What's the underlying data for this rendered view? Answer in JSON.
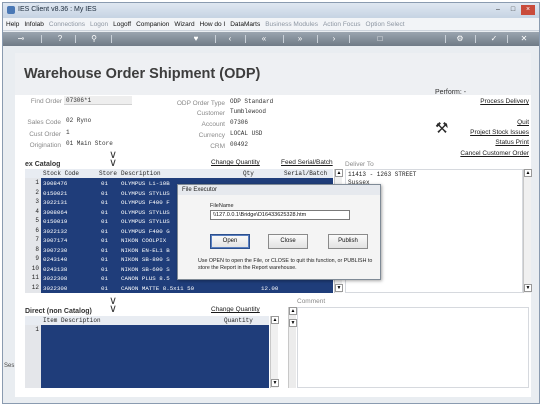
{
  "window": {
    "title": "IES Client v8.36 : My IES"
  },
  "menu": [
    {
      "label": "Help",
      "enabled": true
    },
    {
      "label": "Infolab",
      "enabled": true
    },
    {
      "label": "Connections",
      "enabled": false
    },
    {
      "label": "Logon",
      "enabled": false
    },
    {
      "label": "Logoff",
      "enabled": true
    },
    {
      "label": "Companion",
      "enabled": true
    },
    {
      "label": "Wizard",
      "enabled": true
    },
    {
      "label": "How do I",
      "enabled": true
    },
    {
      "label": "DataMarts",
      "enabled": true
    },
    {
      "label": "Business Modules",
      "enabled": false
    },
    {
      "label": "Action Focus",
      "enabled": false
    },
    {
      "label": "Option Select",
      "enabled": false
    }
  ],
  "page": {
    "title": "Warehouse Order Shipment (ODP)",
    "find_order_label": "Find Order",
    "find_order_value": "07306*1",
    "sales_code_label": "Sales Code",
    "sales_code_value": "02 Ryno",
    "cust_order_label": "Cust Order",
    "cust_order_value": "1",
    "origination_label": "Origination",
    "origination_value": "01 Main Store",
    "odp_order_type_label": "ODP Order Type",
    "odp_order_type_value": "ODP Standard",
    "customer_label": "Customer",
    "customer_value": "Tumblewood",
    "account_label": "Account",
    "account_value": "07306",
    "currency_label": "Currency",
    "currency_value": "LOCAL USD",
    "crm_label": "CRM",
    "crm_value": "00492"
  },
  "perform": {
    "label": "Perform: -",
    "links": [
      "Process Delivery",
      "Quit",
      "Project Stock Issues",
      "Status Print",
      "Cancel Customer Order"
    ]
  },
  "catalog": {
    "title": "ex Catalog",
    "change_quantity": "Change Quantity",
    "feed_serial": "Feed Serial/Batch",
    "columns": [
      "Stock Code",
      "Store",
      "Description",
      "Qty",
      "Serial/Batch"
    ],
    "rows": [
      {
        "n": "1",
        "code": "3008476",
        "store": "01",
        "desc": "OLYMPUS Li-10B",
        "qty": ""
      },
      {
        "n": "2",
        "code": "0150021",
        "store": "01",
        "desc": "OLYMPUS STYLUS",
        "qty": ""
      },
      {
        "n": "3",
        "code": "3022131",
        "store": "01",
        "desc": "OLYMPUS F400 F",
        "qty": ""
      },
      {
        "n": "4",
        "code": "3008064",
        "store": "01",
        "desc": "OLYMPUS STYLUS",
        "qty": ""
      },
      {
        "n": "5",
        "code": "0150019",
        "store": "01",
        "desc": "OLYMPUS STYLUS",
        "qty": ""
      },
      {
        "n": "6",
        "code": "3022132",
        "store": "01",
        "desc": "OLYMPUS F400 G",
        "qty": ""
      },
      {
        "n": "7",
        "code": "3007174",
        "store": "01",
        "desc": "NIKON COOLPIX",
        "qty": ""
      },
      {
        "n": "8",
        "code": "3007230",
        "store": "01",
        "desc": "NIKON EN-EL1 B",
        "qty": ""
      },
      {
        "n": "9",
        "code": "0243140",
        "store": "01",
        "desc": "NIKON SB-800 S",
        "qty": ""
      },
      {
        "n": "10",
        "code": "0243138",
        "store": "01",
        "desc": "NIKON SB-600 S",
        "qty": ""
      },
      {
        "n": "11",
        "code": "3022308",
        "store": "01",
        "desc": "CANON PLUS 8.5",
        "qty": ""
      },
      {
        "n": "12",
        "code": "3022300",
        "store": "01",
        "desc": "CANON MATTE 8.5x11 50",
        "qty": "12.00"
      }
    ]
  },
  "deliver_to": {
    "label": "Deliver To",
    "line1": "11413 - 1263 STREET",
    "line2": "Sussex"
  },
  "direct": {
    "title": "Direct (non Catalog)",
    "change_quantity": "Change Quantity",
    "columns": [
      "Item Description",
      "Quantity"
    ],
    "row_numbers": [
      "1"
    ]
  },
  "comment": {
    "label": "Comment"
  },
  "dialog": {
    "title": "File Executor",
    "filename_label": "FileName",
    "filename_value": "\\\\127.0.0.1\\Bridge\\D16433625328.htm",
    "open": "Open",
    "close": "Close",
    "publish": "Publish",
    "message": "Use OPEN to open the File, or CLOSE to quit this function, or PUBLISH to store the Report in the Report warehouse."
  },
  "side_label": "Ses"
}
